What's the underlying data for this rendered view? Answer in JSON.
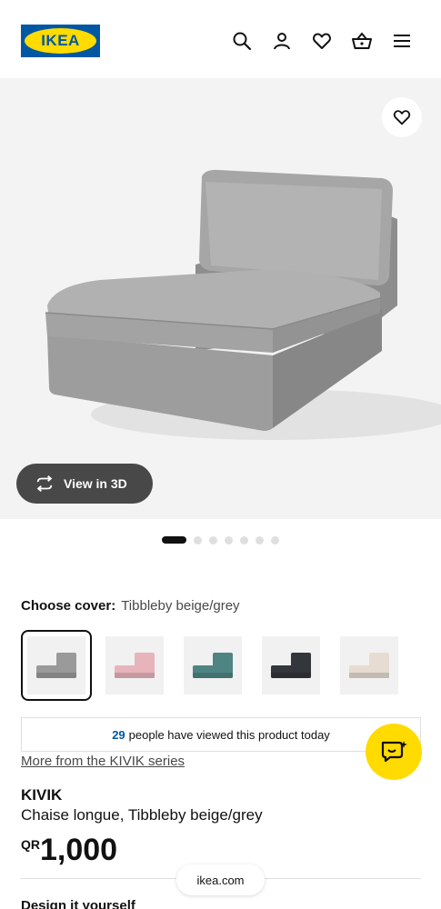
{
  "header": {
    "logo_text": "IKEA",
    "icons": [
      "search-icon",
      "account-icon",
      "heart-icon",
      "basket-icon",
      "menu-icon"
    ]
  },
  "gallery": {
    "view_3d_label": "View in 3D",
    "dot_count": 7,
    "active_dot": 0
  },
  "cover": {
    "label": "Choose cover:",
    "selected_value": "Tibbleby beige/grey",
    "swatches": [
      {
        "color": "#9a9a9a",
        "selected": true
      },
      {
        "color": "#e8b4bc",
        "selected": false
      },
      {
        "color": "#4e8583",
        "selected": false
      },
      {
        "color": "#33363a",
        "selected": false
      },
      {
        "color": "#e6dcd1",
        "selected": false
      }
    ]
  },
  "viewed": {
    "count": "29",
    "text": "people have viewed this product today"
  },
  "series_link": "More from the KIVIK series",
  "product": {
    "name": "KIVIK",
    "description": "Chaise longue, Tibbleby beige/grey",
    "currency": "QR",
    "price": "1,000"
  },
  "section_heading": "Design it yourself",
  "browser_url": "ikea.com",
  "colors": {
    "brand_blue": "#0058a3",
    "brand_yellow": "#ffdb00"
  }
}
